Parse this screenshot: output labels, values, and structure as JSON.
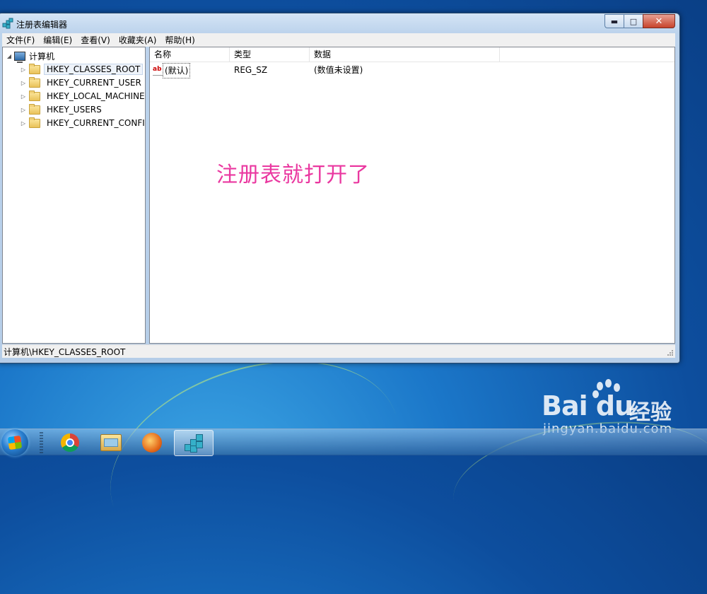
{
  "window": {
    "title": "注册表编辑器",
    "caption": {
      "minimize": "▬",
      "maximize": "□",
      "close": "✕"
    }
  },
  "menubar": [
    "文件(F)",
    "编辑(E)",
    "查看(V)",
    "收藏夹(A)",
    "帮助(H)"
  ],
  "tree": {
    "root": "计算机",
    "root_toggle": "◢",
    "child_toggle": "▷",
    "items": [
      "HKEY_CLASSES_ROOT",
      "HKEY_CURRENT_USER",
      "HKEY_LOCAL_MACHINE",
      "HKEY_USERS",
      "HKEY_CURRENT_CONFIG"
    ],
    "selected_index": 0
  },
  "list": {
    "columns": [
      "名称",
      "类型",
      "数据"
    ],
    "rows": [
      {
        "icon": "ab",
        "name": "(默认)",
        "type": "REG_SZ",
        "data": "(数值未设置)"
      }
    ]
  },
  "annotation": "注册表就打开了",
  "statusbar": "计算机\\HKEY_CLASSES_ROOT",
  "watermark": {
    "logo": "Bai du",
    "cn": "经验",
    "url": "jingyan.baidu.com"
  },
  "colors": {
    "annotation": "#ea38a0",
    "desktop": "#1b77c9"
  },
  "taskbar": {
    "icons": [
      "start-orb-icon",
      "chrome-icon",
      "file-explorer-icon",
      "foxmail-icon",
      "regedit-icon"
    ],
    "active_index": 4
  }
}
